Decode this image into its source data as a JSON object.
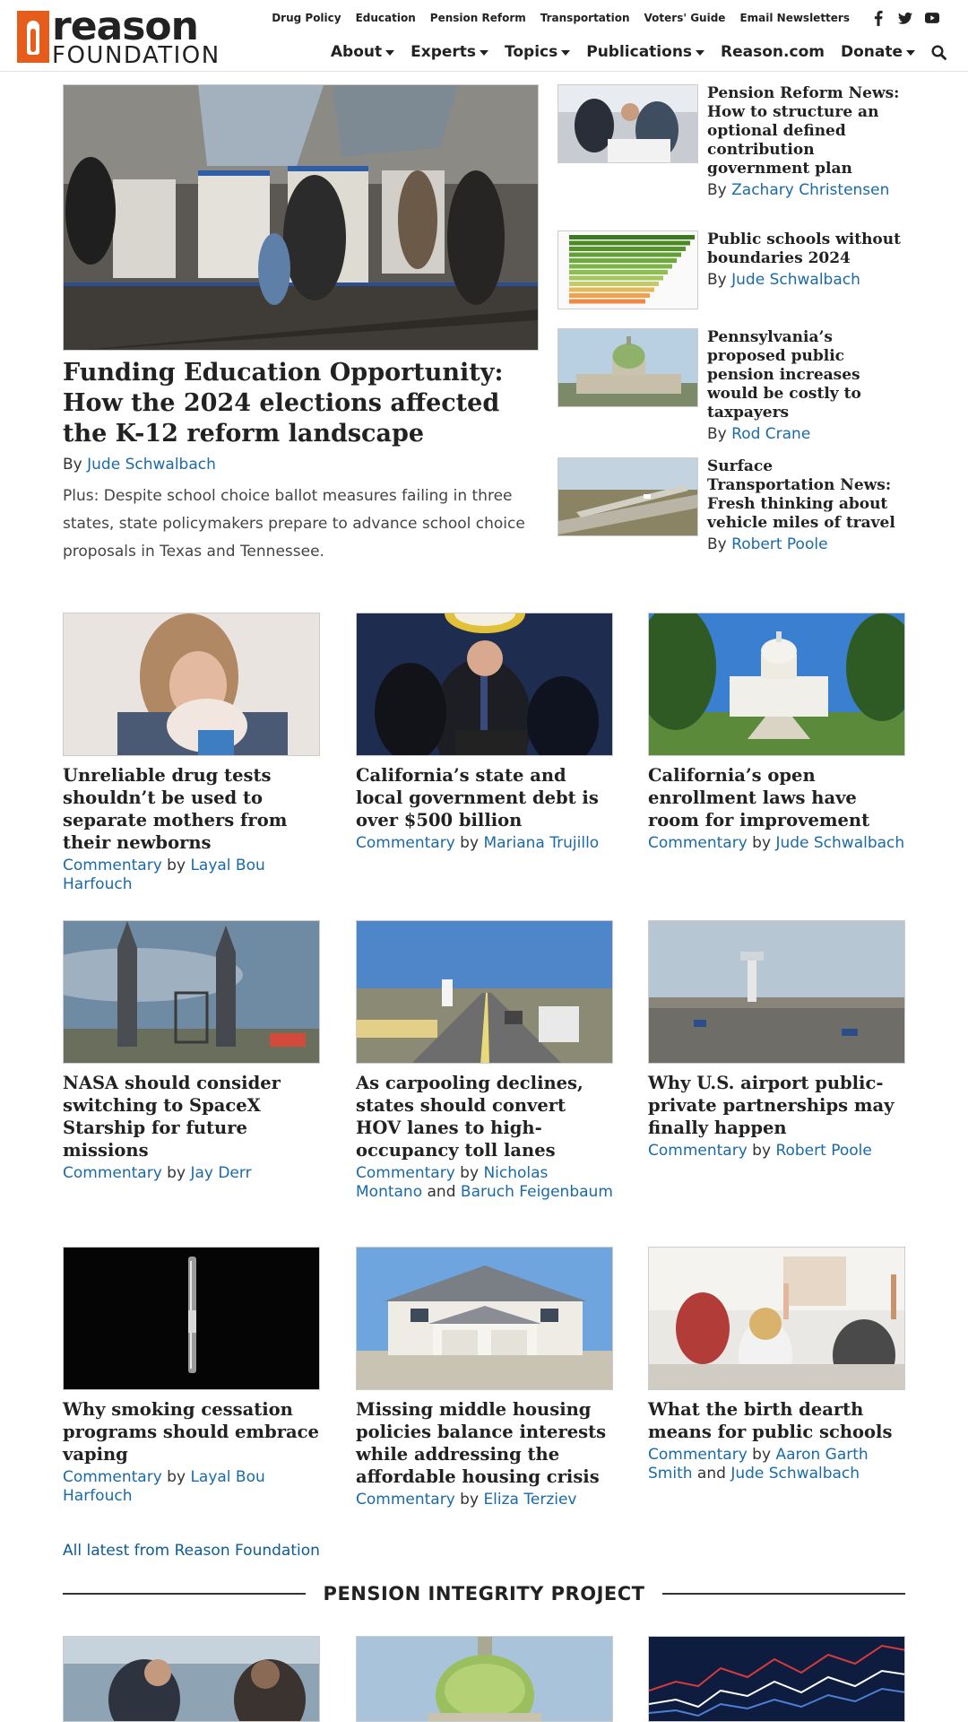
{
  "brand": {
    "word1": "reason",
    "word2": "FOUNDATION",
    "accent": "#e55c1b",
    "link": "#1a6aa6"
  },
  "topnav": [
    "Drug Policy",
    "Education",
    "Pension Reform",
    "Transportation",
    "Voters' Guide",
    "Email Newsletters"
  ],
  "social": [
    "facebook-icon",
    "twitter-icon",
    "youtube-icon"
  ],
  "mainnav": [
    {
      "label": "About",
      "dropdown": true
    },
    {
      "label": "Experts",
      "dropdown": true
    },
    {
      "label": "Topics",
      "dropdown": true
    },
    {
      "label": "Publications",
      "dropdown": true
    },
    {
      "label": "Reason.com",
      "dropdown": false
    },
    {
      "label": "Donate",
      "dropdown": true
    }
  ],
  "feature": {
    "title": "Funding Education Opportunity: How the 2024 elections affected the K-12 reform landscape",
    "by": "By",
    "author": "Jude Schwalbach",
    "excerpt": "Plus: Despite school choice ballot measures failing in three states, state policymakers prepare to advance school choice proposals in Texas and Tennessee."
  },
  "side": [
    {
      "title": "Pension Reform News: How to structure an optional defined contribution government plan",
      "by": "By",
      "author": "Zachary Christensen"
    },
    {
      "title": "Public schools without boundaries 2024",
      "by": "By",
      "author": "Jude Schwalbach"
    },
    {
      "title": "Pennsylvania’s proposed public pension increases would be costly to taxpayers",
      "by": "By",
      "author": "Rod Crane"
    },
    {
      "title": "Surface Transportation News: Fresh thinking about vehicle miles of travel",
      "by": "By",
      "author": "Robert Poole"
    }
  ],
  "cards": [
    {
      "title": "Unreliable drug tests shouldn’t be used to separate mothers from their newborns",
      "type": "Commentary",
      "by": "by",
      "author": "Layal Bou Harfouch"
    },
    {
      "title": "California’s state and local government debt is over $500 billion",
      "type": "Commentary",
      "by": "by",
      "author": "Mariana Trujillo"
    },
    {
      "title": "California’s open enrollment laws have room for improvement",
      "type": "Commentary",
      "by": "by",
      "author": "Jude Schwalbach"
    },
    {
      "title": "NASA should consider switching to SpaceX Starship for future missions",
      "type": "Commentary",
      "by": "by",
      "author": "Jay Derr"
    },
    {
      "title": "As carpooling declines, states should convert HOV lanes to high-occupancy toll lanes",
      "type": "Commentary",
      "by": "by",
      "author": "Nicholas Montano",
      "and": "and",
      "author2": "Baruch Feigenbaum"
    },
    {
      "title": "Why U.S. airport public-private partnerships may finally happen",
      "type": "Commentary",
      "by": "by",
      "author": "Robert Poole"
    },
    {
      "title": "Why smoking cessation programs should embrace vaping",
      "type": "Commentary",
      "by": "by",
      "author": "Layal Bou Harfouch"
    },
    {
      "title": "Missing middle housing policies balance interests while addressing the affordable housing crisis",
      "type": "Commentary",
      "by": "by",
      "author": "Eliza Terziev"
    },
    {
      "title": "What the birth dearth means for public schools",
      "type": "Commentary",
      "by": "by",
      "author": "Aaron Garth Smith",
      "and": "and",
      "author2": "Jude Schwalbach"
    }
  ],
  "all_latest": "All latest from Reason Foundation",
  "section": "PENSION INTEGRITY PROJECT"
}
